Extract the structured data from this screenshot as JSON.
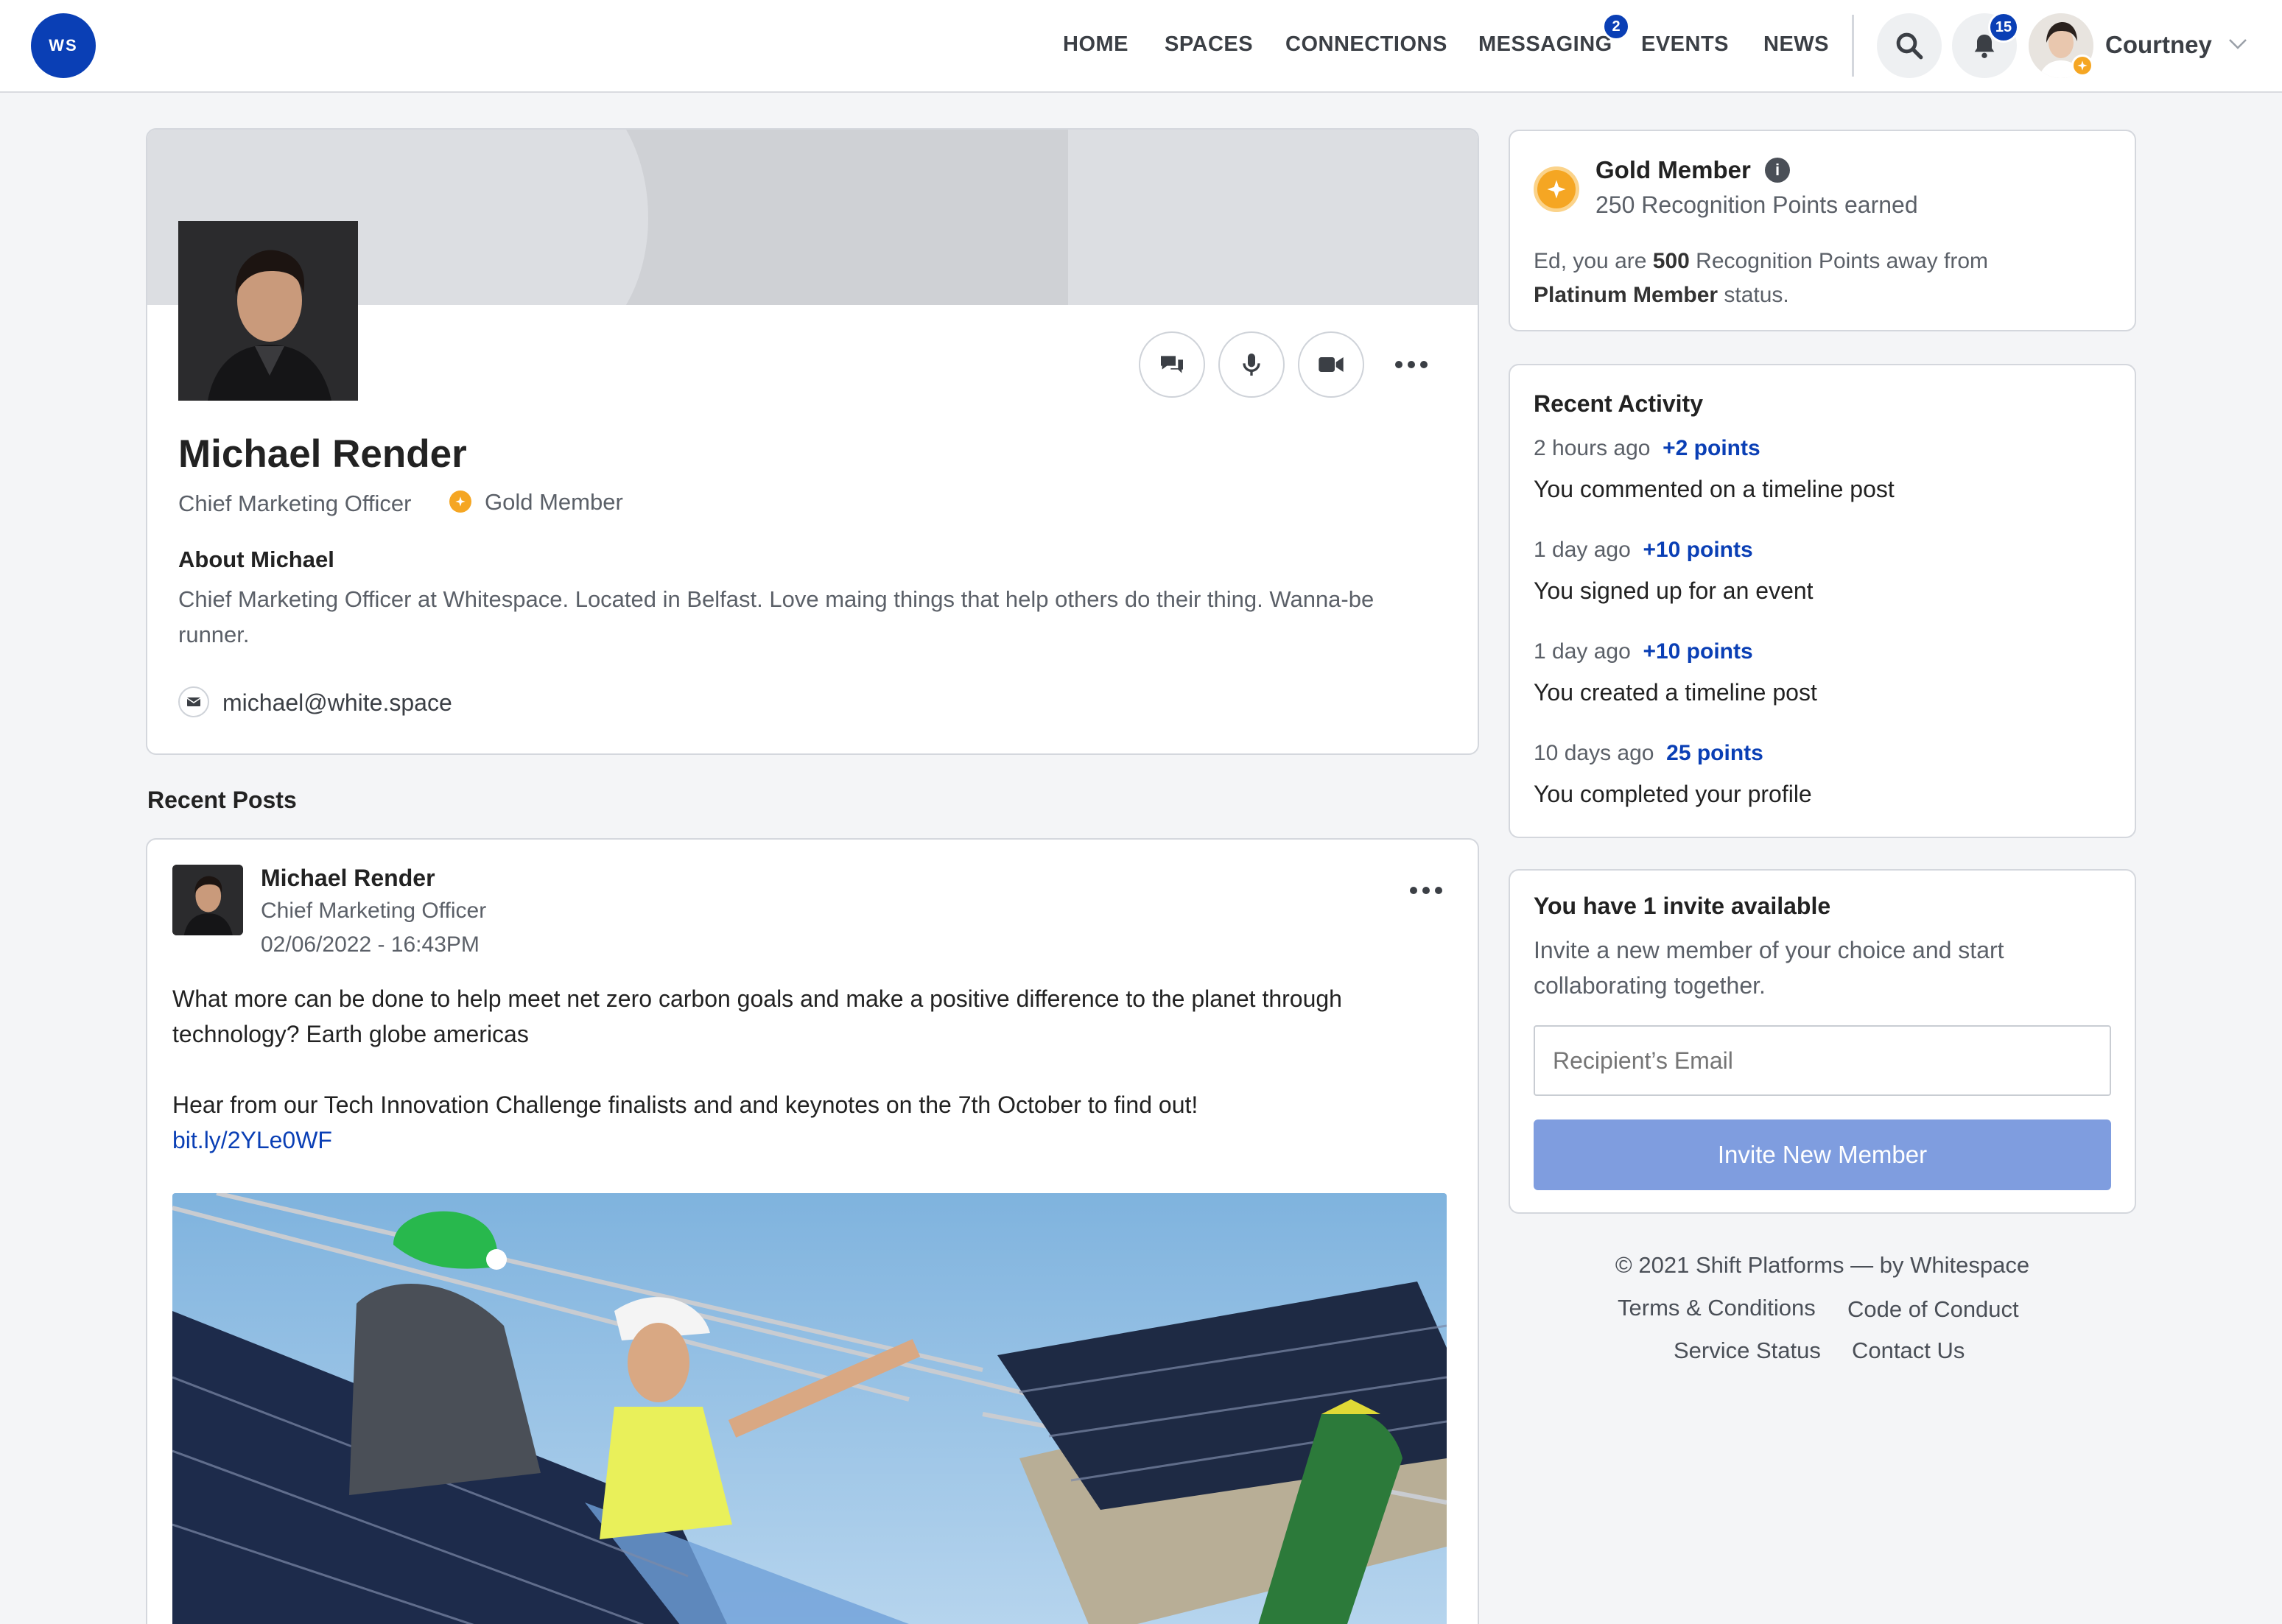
{
  "app": {
    "logo_text": "WS",
    "brand_color": "#0a3fb5"
  },
  "nav": {
    "items": [
      "HOME",
      "SPACES",
      "CONNECTIONS",
      "MESSAGING",
      "EVENTS",
      "NEWS"
    ],
    "messaging_badge": "2",
    "notifications_badge": "15",
    "user_name": "Courtney"
  },
  "profile": {
    "name": "Michael Render",
    "title": "Chief Marketing Officer",
    "membership": "Gold Member",
    "about_heading": "About Michael",
    "about_text": "Chief Marketing Officer at Whitespace. Located in Belfast. Love maing things that help others do their thing. Wanna-be runner.",
    "email": "michael@white.space"
  },
  "recent_posts": {
    "heading": "Recent Posts",
    "post": {
      "author": "Michael Render",
      "author_title": "Chief Marketing Officer",
      "timestamp": "02/06/2022 - 16:43PM",
      "paragraph1": "What more can be done to help meet net zero carbon goals and make a positive difference to the planet through technology? Earth globe americas",
      "paragraph2": "Hear from our Tech Innovation Challenge finalists and and keynotes on the 7th October to find out!",
      "link": "bit.ly/2YLe0WF"
    }
  },
  "gold": {
    "title": "Gold Member",
    "points": "250 Recognition Points earned",
    "away_prefix": "Ed, you are ",
    "away_points": "500",
    "away_middle": " Recognition Points away from",
    "away_status": "Platinum Member",
    "away_suffix": " status."
  },
  "activity": {
    "heading": "Recent Activity",
    "items": [
      {
        "time": "2 hours ago",
        "points": "+2 points",
        "text": "You commented on a timeline post"
      },
      {
        "time": "1 day ago",
        "points": "+10 points",
        "text": "You signed up for an event"
      },
      {
        "time": "1 day ago",
        "points": "+10 points",
        "text": "You created a timeline post"
      },
      {
        "time": "10 days ago",
        "points": "25 points",
        "text": "You completed your profile"
      }
    ]
  },
  "invite": {
    "heading": "You have 1 invite available",
    "text": "Invite a new member of your choice and start collaborating together.",
    "placeholder": "Recipient’s Email",
    "button": "Invite New Member"
  },
  "footer": {
    "copyright": "© 2021 Shift Platforms — by Whitespace",
    "links": [
      "Terms & Conditions",
      "Code of Conduct",
      "Service Status",
      "Contact Us"
    ]
  }
}
